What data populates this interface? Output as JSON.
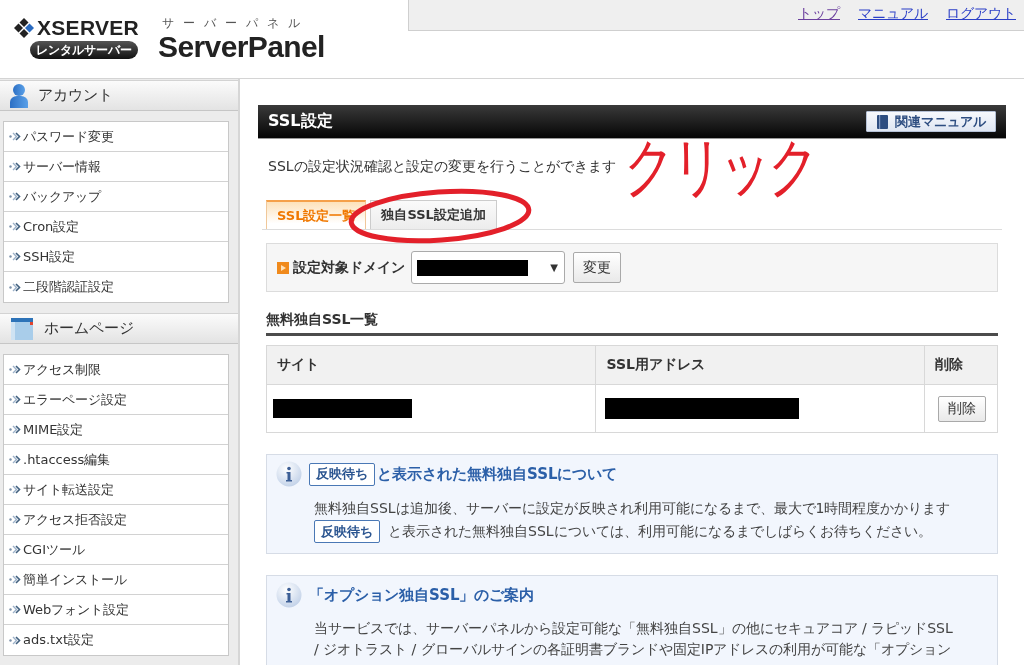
{
  "header": {
    "logo": {
      "brand": "XSERVER",
      "badge": "レンタルサーバー"
    },
    "product": {
      "caption": "サーバーパネル",
      "name": "ServerPanel"
    },
    "links": [
      {
        "label": "トップ",
        "visited": true
      },
      {
        "label": "マニュアル",
        "visited": false
      },
      {
        "label": "ログアウト",
        "visited": false
      }
    ]
  },
  "sidebar": {
    "sections": [
      {
        "kind": "account",
        "title": "アカウント",
        "items": [
          "パスワード変更",
          "サーバー情報",
          "バックアップ",
          "Cron設定",
          "SSH設定",
          "二段階認証設定"
        ]
      },
      {
        "kind": "homepage",
        "title": "ホームページ",
        "items": [
          "アクセス制限",
          "エラーページ設定",
          "MIME設定",
          ".htaccess編集",
          "サイト転送設定",
          "アクセス拒否設定",
          "CGIツール",
          "簡単インストール",
          "Webフォント設定",
          "ads.txt設定"
        ]
      }
    ]
  },
  "panel": {
    "title": "SSL設定",
    "manual_button": "関連マニュアル",
    "description": "SSLの設定状況確認と設定の変更を行うことができます",
    "tabs": [
      {
        "label": "SSL設定一覧",
        "selected": true
      },
      {
        "label": "独自SSL設定追加",
        "selected": false
      }
    ],
    "domain_filter": {
      "label": "設定対象ドメイン",
      "dropdown_arrow": "▼",
      "button": "変更"
    },
    "section_title": "無料独自SSL一覧",
    "table": {
      "columns": [
        "サイト",
        "SSL用アドレス",
        "削除"
      ],
      "rows": [
        {
          "delete_button": "削除"
        }
      ]
    },
    "notices": [
      {
        "title_badge": "反映待ち",
        "title": "と表示された無料独自SSLについて",
        "paragraphs": [
          {
            "text": "無料独自SSLは追加後、サーバーに設定が反映され利用可能になるまで、最大で1時間程度かかります"
          },
          {
            "badge": "反映待ち",
            "text": "と表示された無料独自SSLについては、利用可能になるまでしばらくお待ちください。"
          }
        ]
      },
      {
        "title": "「オプション独自SSL」のご案内",
        "paragraphs": [
          {
            "text": "当サービスでは、サーバーパネルから設定可能な「無料独自SSL」の他にセキュアコア / ラピッドSSL / ジオトラスト / グローバルサインの各証明書ブランドや固定IPアドレスの利用が可能な「オプション"
          }
        ]
      }
    ]
  },
  "annotation": {
    "text": "クリック"
  }
}
